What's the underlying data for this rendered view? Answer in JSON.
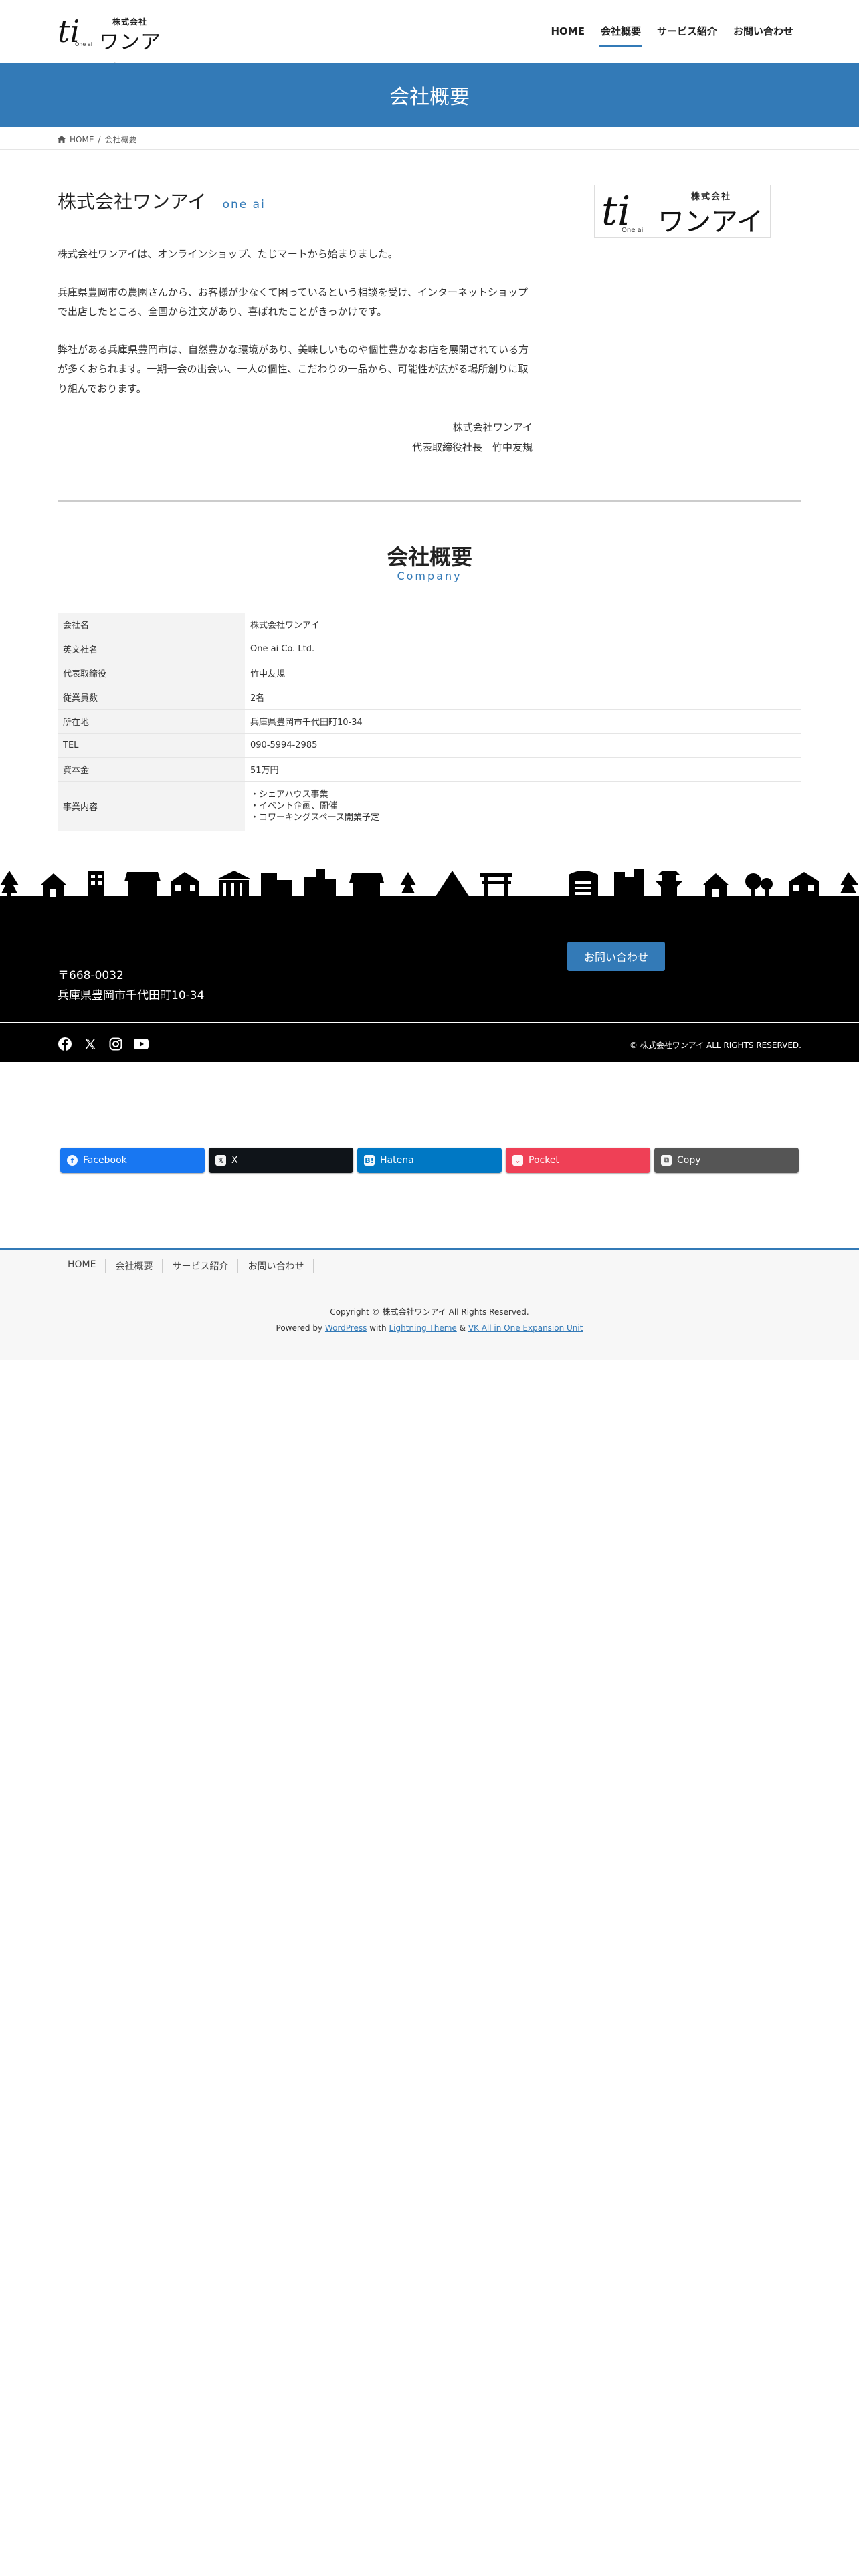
{
  "header": {
    "logo": {
      "small": "株式会社",
      "big": "ワンアイ",
      "mark": "ti",
      "tiny": "One ai"
    },
    "nav": [
      "HOME",
      "会社概要",
      "サービス紹介",
      "お問い合わせ"
    ],
    "active_nav_index": 1
  },
  "banner": {
    "title": "会社概要"
  },
  "breadcrumb": {
    "home": "HOME",
    "separator": "/",
    "current": "会社概要"
  },
  "intro": {
    "title": "株式会社ワンアイ",
    "subtitle": "one ai",
    "paragraphs": [
      "株式会社ワンアイは、オンラインショップ、たじマートから始まりました。",
      "兵庫県豊岡市の農園さんから、お客様が少なくて困っているという相談を受け、インターネットショップで出店したところ、全国から注文があり、喜ばれたことがきっかけです。",
      "弊社がある兵庫県豊岡市は、自然豊かな環境があり、美味しいものや個性豊かなお店を展開されている方が多くおられます。一期一会の出会い、一人の個性、こだわりの一品から、可能性が広がる場所創りに取り組んでおります。"
    ],
    "signature_company": "株式会社ワンアイ",
    "signature_person": "代表取締役社長　竹中友規"
  },
  "company": {
    "title": "会社概要",
    "subtitle": "Company",
    "rows": [
      {
        "label": "会社名",
        "value": "株式会社ワンアイ"
      },
      {
        "label": "英文社名",
        "value": "One ai Co. Ltd."
      },
      {
        "label": "代表取締役",
        "value": "竹中友規"
      },
      {
        "label": "従業員数",
        "value": "2名"
      },
      {
        "label": "所在地",
        "value": "兵庫県豊岡市千代田町10-34"
      },
      {
        "label": "TEL",
        "value": "090-5994-2985"
      },
      {
        "label": "資本金",
        "value": "51万円"
      },
      {
        "label": "事業内容",
        "lines": [
          "・シェアハウス事業",
          "・イベント企画、開催",
          "・コワーキングスペース開業予定"
        ]
      }
    ]
  },
  "footer_dark": {
    "postal": "〒668-0032",
    "address": "兵庫県豊岡市千代田町10-34",
    "contact_button": "お問い合わせ",
    "copyright": "©  株式会社ワンアイ  ALL RIGHTS RESERVED.",
    "social_icons": [
      "facebook-icon",
      "x-icon",
      "instagram-icon",
      "youtube-icon"
    ]
  },
  "share": [
    {
      "label": "Facebook",
      "color": "#1877f2",
      "icon": "facebook-icon"
    },
    {
      "label": "X",
      "color": "#0f1419",
      "icon": "x-icon"
    },
    {
      "label": "Hatena",
      "color": "#0078c4",
      "icon": "hatena-icon"
    },
    {
      "label": "Pocket",
      "color": "#ef4056",
      "icon": "pocket-icon"
    },
    {
      "label": "Copy",
      "color": "#555555",
      "icon": "copy-icon"
    }
  ],
  "site_footer": {
    "nav": [
      "HOME",
      "会社概要",
      "サービス紹介",
      "お問い合わせ"
    ],
    "copyright": "Copyright © 株式会社ワンアイ All Rights Reserved.",
    "powered_prefix": "Powered by",
    "wordpress": "WordPress",
    "with": "with",
    "theme": "Lightning Theme",
    "amp": "&",
    "plugin": "VK All in One Expansion Unit"
  },
  "colors": {
    "accent": "#337ab7",
    "dark": "#000000"
  }
}
